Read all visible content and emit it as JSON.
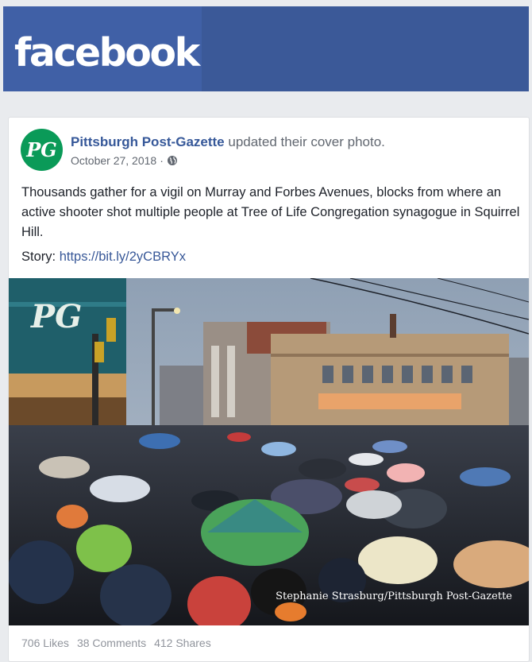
{
  "header": {
    "logo_text": "facebook",
    "brand_color": "#3b5998"
  },
  "post": {
    "avatar_text": "PG",
    "page_name": "Pittsburgh Post-Gazette",
    "action": "updated their cover photo.",
    "date": "October 27, 2018",
    "separator": "·",
    "privacy_icon": "globe-icon",
    "text": "Thousands gather for a vigil on Murray and Forbes Avenues, blocks from where an active shooter shot multiple people at Tree of Life Congregation synagogue in Squirrel Hill.",
    "story_label": "Story:",
    "story_link": "https://bit.ly/2yCBRYx",
    "photo": {
      "caption": "Stephanie Strasburg/Pittsburgh Post-Gazette",
      "sign_text": "PG"
    },
    "stats": {
      "likes": "706 Likes",
      "comments": "38 Comments",
      "shares": "412 Shares"
    }
  }
}
